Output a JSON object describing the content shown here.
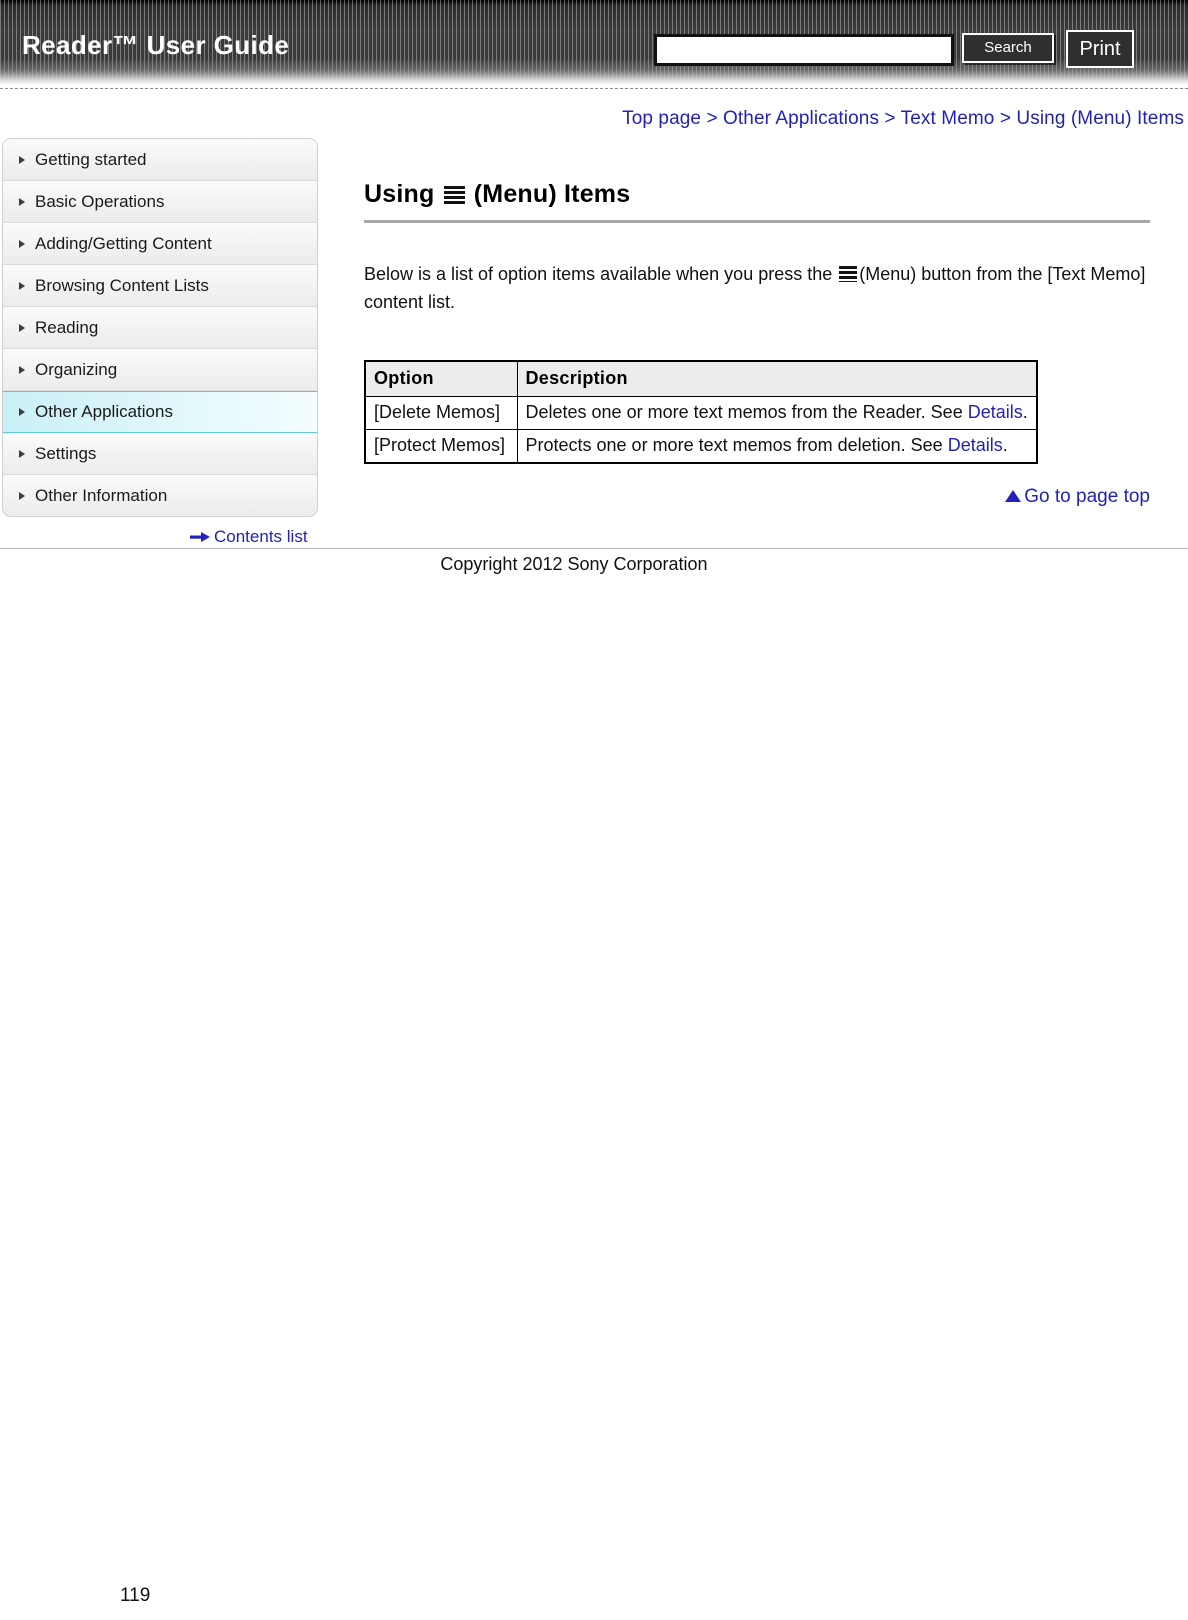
{
  "header": {
    "title": "Reader™ User Guide",
    "search_value": "",
    "search_placeholder": "",
    "search_button": "Search",
    "print_button": "Print"
  },
  "breadcrumb": {
    "text": "Top page > Other Applications > Text Memo > Using (Menu) Items"
  },
  "sidebar": {
    "items": [
      {
        "label": "Getting started",
        "active": false
      },
      {
        "label": "Basic Operations",
        "active": false
      },
      {
        "label": "Adding/Getting Content",
        "active": false
      },
      {
        "label": "Browsing Content Lists",
        "active": false
      },
      {
        "label": "Reading",
        "active": false
      },
      {
        "label": "Organizing",
        "active": false
      },
      {
        "label": "Other Applications",
        "active": true
      },
      {
        "label": "Settings",
        "active": false
      },
      {
        "label": "Other Information",
        "active": false
      }
    ],
    "contents_list_label": "Contents list"
  },
  "main": {
    "heading_before_icon": "Using",
    "heading_icon": "menu-hamburger-icon",
    "heading_after_icon": "(Menu) Items",
    "paragraph_part1": "Below is a list of option items available when you press the",
    "paragraph_icon": "menu-hamburger-icon",
    "paragraph_part2": "(Menu) button from the [Text Memo] content list.",
    "table": {
      "headers": [
        "Option",
        "Description"
      ],
      "rows": [
        {
          "option": "[Delete Memos]",
          "description_text": "Deletes one or more text memos from the Reader. See",
          "description_link": "Details",
          "description_end": "."
        },
        {
          "option": "[Protect Memos]",
          "description_text": "Protects one or more text memos from deletion. See",
          "description_link": "Details",
          "description_end": "."
        }
      ]
    },
    "page_top_label": "Go to page top"
  },
  "footer": {
    "copyright": "Copyright 2012 Sony Corporation",
    "page_number": "119"
  },
  "colors": {
    "link": "#2222bb",
    "header_bg": "#3a3a3a",
    "active_item": "#c9f0f7",
    "table_header_bg": "#ececec"
  }
}
